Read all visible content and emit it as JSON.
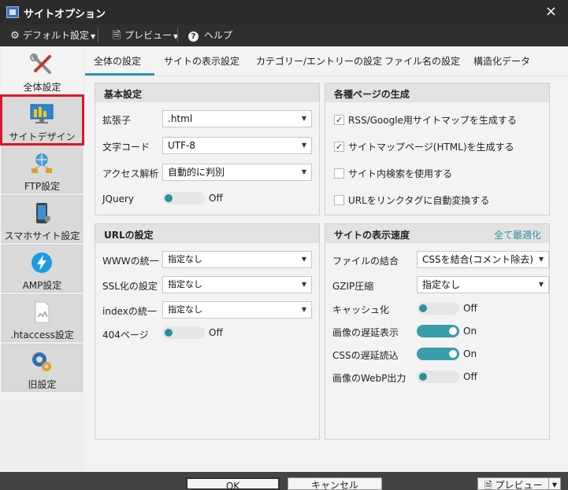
{
  "window": {
    "title": "サイトオプション",
    "close": "×"
  },
  "toolbar": {
    "default_settings": "デフォルト設定",
    "preview": "プレビュー",
    "help": "ヘルプ"
  },
  "sidebar": {
    "items": [
      {
        "label": "全体設定",
        "icon": "tools-icon"
      },
      {
        "label": "サイトデザイン",
        "icon": "monitor-icon"
      },
      {
        "label": "FTP設定",
        "icon": "network-icon"
      },
      {
        "label": "スマホサイト設定",
        "icon": "smartphone-icon"
      },
      {
        "label": "AMP設定",
        "icon": "lightning-icon"
      },
      {
        "label": ".htaccess設定",
        "icon": "file-icon"
      },
      {
        "label": "旧設定",
        "icon": "gears-icon"
      }
    ]
  },
  "tabs": [
    "全体の設定",
    "サイトの表示設定",
    "カテゴリー/エントリーの設定",
    "ファイル名の設定",
    "構造化データ"
  ],
  "basic": {
    "title": "基本設定",
    "extension_label": "拡張子",
    "extension_value": ".html",
    "charset_label": "文字コード",
    "charset_value": "UTF-8",
    "analytics_label": "アクセス解析",
    "analytics_value": "自動的に判別",
    "jquery_label": "JQuery",
    "jquery_state": "Off"
  },
  "pages": {
    "title": "各種ページの生成",
    "items": [
      {
        "label": "RSS/Google用サイトマップを生成する",
        "checked": "✓"
      },
      {
        "label": "サイトマップページ(HTML)を生成する",
        "checked": "✓"
      },
      {
        "label": "サイト内検索を使用する",
        "checked": ""
      },
      {
        "label": "URLをリンクタグに自動変換する",
        "checked": ""
      }
    ]
  },
  "url": {
    "title": "URLの設定",
    "www_label": "WWWの統一",
    "www_value": "指定なし",
    "ssl_label": "SSL化の設定",
    "ssl_value": "指定なし",
    "index_label": "indexの統一",
    "index_value": "指定なし",
    "p404_label": "404ページ",
    "p404_state": "Off"
  },
  "speed": {
    "title": "サイトの表示速度",
    "optimize_link": "全て最適化",
    "combine_label": "ファイルの結合",
    "combine_value": "CSSを結合(コメント除去)",
    "gzip_label": "GZIP圧縮",
    "gzip_value": "指定なし",
    "cache_label": "キャッシュ化",
    "cache_state": "Off",
    "lazy_label": "画像の遅延表示",
    "lazy_state": "On",
    "cssdefer_label": "CSSの遅延読込",
    "cssdefer_state": "On",
    "webp_label": "画像のWebP出力",
    "webp_state": "Off"
  },
  "footer": {
    "ok": "OK",
    "cancel": "キャンセル",
    "preview": "プレビュー"
  },
  "colors": {
    "accent": "#2b9aa9",
    "highlight": "#d7192a"
  }
}
